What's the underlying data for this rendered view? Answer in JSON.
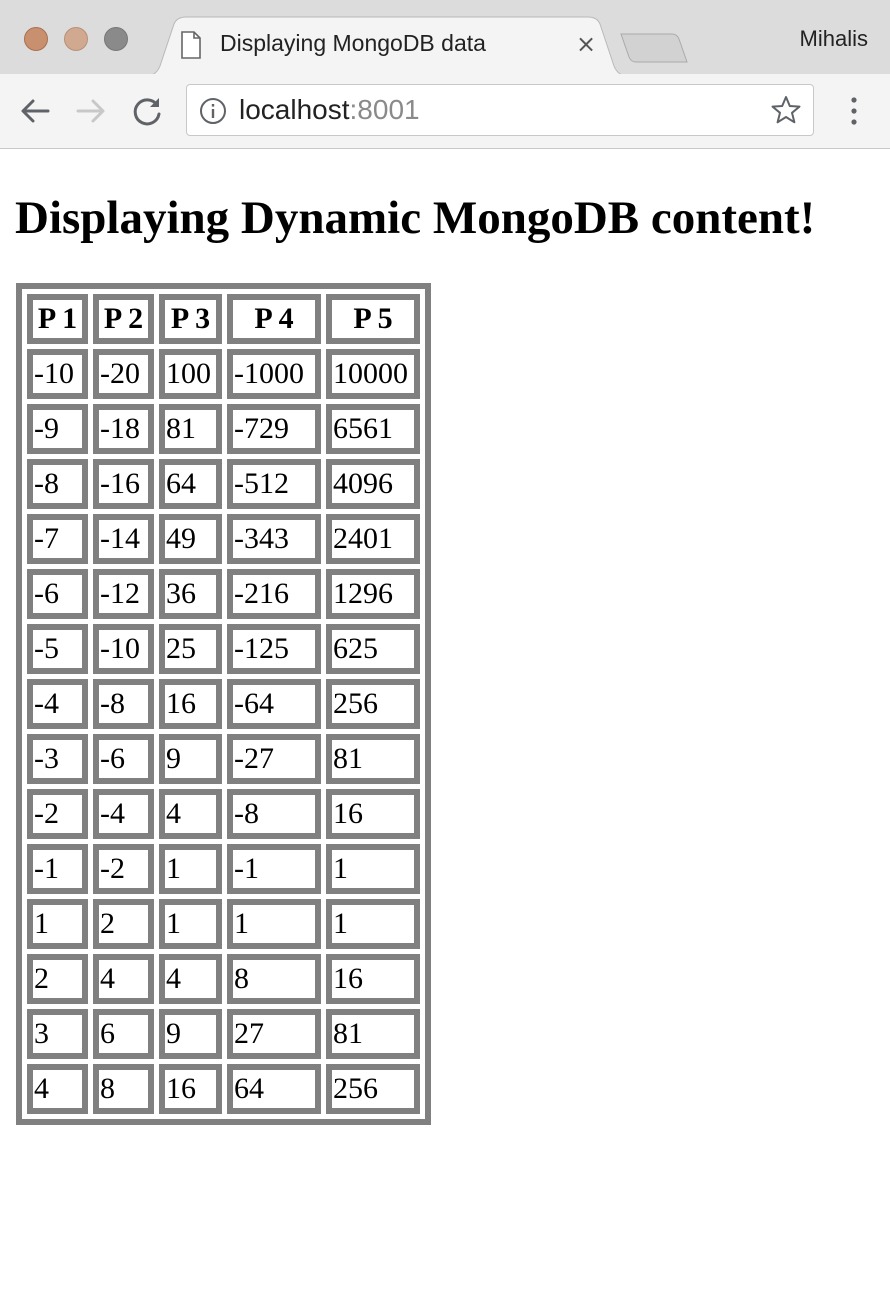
{
  "browser": {
    "tab_title": "Displaying MongoDB data",
    "profile_name": "Mihalis",
    "url_host": "localhost",
    "url_port": ":8001"
  },
  "page": {
    "heading": "Displaying Dynamic MongoDB content!",
    "table": {
      "headers": [
        "P 1",
        "P 2",
        "P 3",
        "P 4",
        "P 5"
      ],
      "rows": [
        [
          "-10",
          "-20",
          "100",
          "-1000",
          "10000"
        ],
        [
          "-9",
          "-18",
          "81",
          "-729",
          "6561"
        ],
        [
          "-8",
          "-16",
          "64",
          "-512",
          "4096"
        ],
        [
          "-7",
          "-14",
          "49",
          "-343",
          "2401"
        ],
        [
          "-6",
          "-12",
          "36",
          "-216",
          "1296"
        ],
        [
          "-5",
          "-10",
          "25",
          "-125",
          "625"
        ],
        [
          "-4",
          "-8",
          "16",
          "-64",
          "256"
        ],
        [
          "-3",
          "-6",
          "9",
          "-27",
          "81"
        ],
        [
          "-2",
          "-4",
          "4",
          "-8",
          "16"
        ],
        [
          "-1",
          "-2",
          "1",
          "-1",
          "1"
        ],
        [
          "1",
          "2",
          "1",
          "1",
          "1"
        ],
        [
          "2",
          "4",
          "4",
          "8",
          "16"
        ],
        [
          "3",
          "6",
          "9",
          "27",
          "81"
        ],
        [
          "4",
          "8",
          "16",
          "64",
          "256"
        ]
      ]
    }
  },
  "colors": {
    "table_border": "#808080",
    "tabstrip_bg": "#dcdcdc",
    "toolbar_bg": "#f4f4f4"
  }
}
